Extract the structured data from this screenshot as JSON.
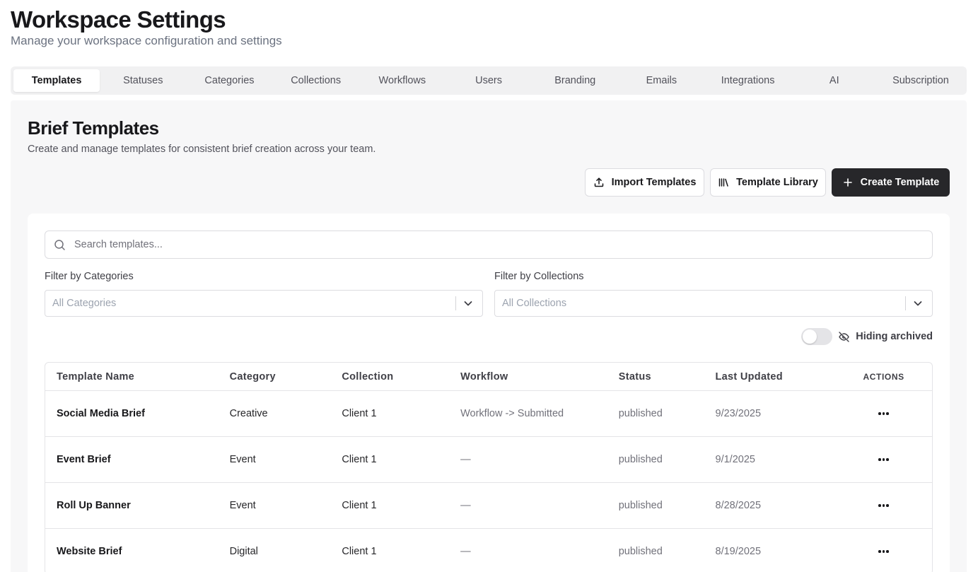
{
  "page": {
    "title": "Workspace Settings",
    "subtitle": "Manage your workspace configuration and settings"
  },
  "tabs": [
    {
      "label": "Templates",
      "active": true
    },
    {
      "label": "Statuses"
    },
    {
      "label": "Categories"
    },
    {
      "label": "Collections"
    },
    {
      "label": "Workflows"
    },
    {
      "label": "Users"
    },
    {
      "label": "Branding"
    },
    {
      "label": "Emails"
    },
    {
      "label": "Integrations"
    },
    {
      "label": "AI"
    },
    {
      "label": "Subscription"
    }
  ],
  "section": {
    "title": "Brief Templates",
    "description": "Create and manage templates for consistent brief creation across your team."
  },
  "actions": {
    "import_label": "Import Templates",
    "library_label": "Template Library",
    "create_label": "Create Template"
  },
  "search": {
    "placeholder": "Search templates...",
    "value": ""
  },
  "filters": {
    "categories_label": "Filter by Categories",
    "categories_value": "All Categories",
    "collections_label": "Filter by Collections",
    "collections_value": "All Collections"
  },
  "archive_toggle": {
    "label": "Hiding archived",
    "on": false
  },
  "table": {
    "headers": [
      "Template Name",
      "Category",
      "Collection",
      "Workflow",
      "Status",
      "Last Updated",
      "ACTIONS"
    ],
    "rows": [
      {
        "name": "Social Media Brief",
        "category": "Creative",
        "collection": "Client 1",
        "workflow": "Workflow -> Submitted",
        "status": "published",
        "updated": "9/23/2025"
      },
      {
        "name": "Event Brief",
        "category": "Event",
        "collection": "Client 1",
        "workflow": "—",
        "status": "published",
        "updated": "9/1/2025"
      },
      {
        "name": "Roll Up Banner",
        "category": "Event",
        "collection": "Client 1",
        "workflow": "—",
        "status": "published",
        "updated": "8/28/2025"
      },
      {
        "name": "Website Brief",
        "category": "Digital",
        "collection": "Client 1",
        "workflow": "—",
        "status": "published",
        "updated": "8/19/2025"
      }
    ]
  },
  "icons": {
    "import": "upload-icon",
    "library": "library-icon",
    "create": "plus-icon",
    "search": "search-icon",
    "dropdown": "chevron-down-icon",
    "archived": "eye-off-icon",
    "row_actions": "more-horizontal-icon"
  },
  "colors": {
    "primary_button": "#27272a",
    "tab_bar": "#f1f1f2",
    "panel_bg": "#f7f7f8"
  }
}
